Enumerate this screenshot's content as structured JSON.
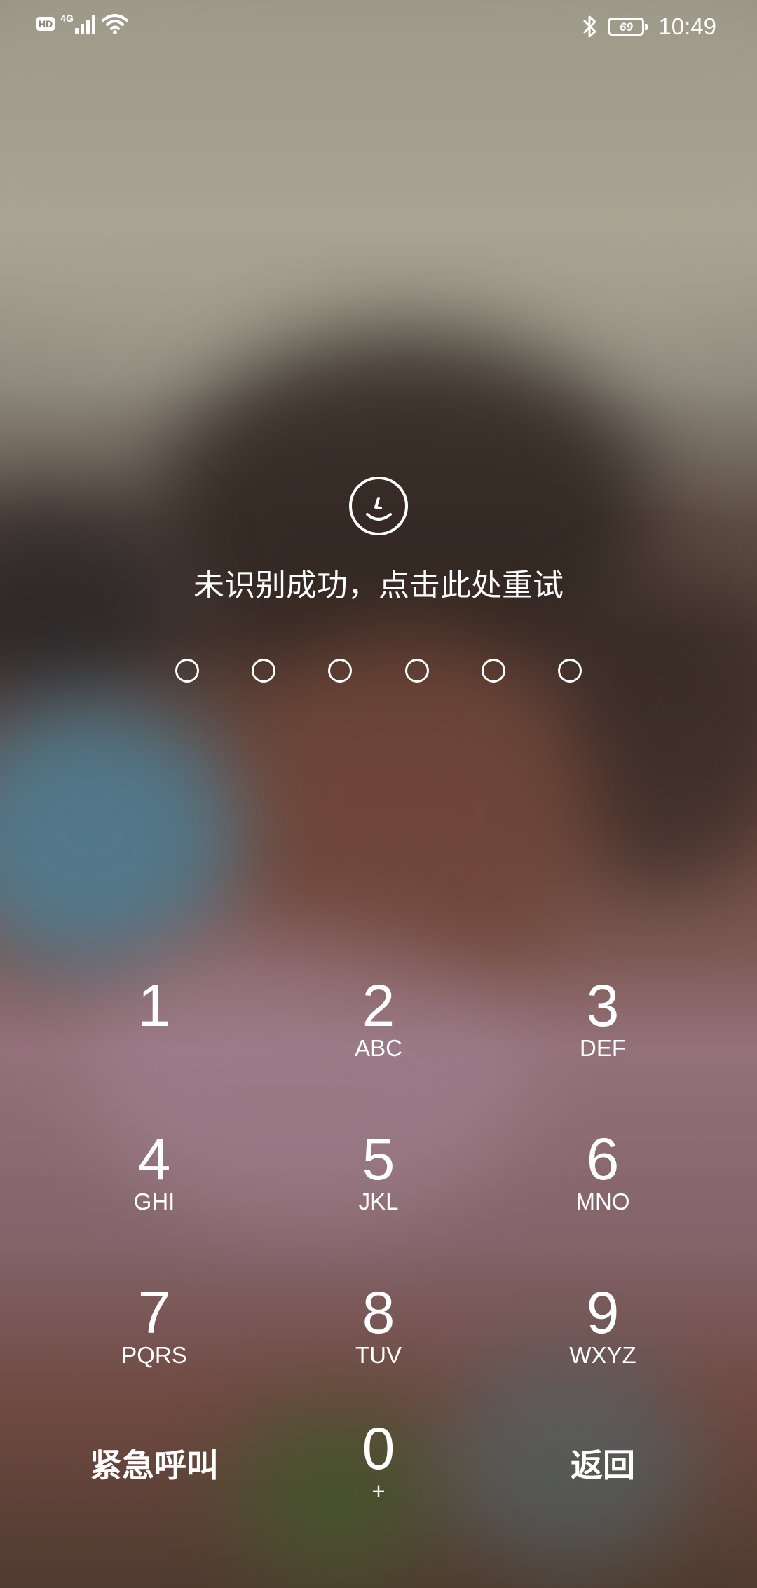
{
  "status_bar": {
    "hd_label": "HD",
    "network_type": "4G",
    "battery_level": "69",
    "time": "10:49",
    "icons": [
      "hd-icon",
      "signal-icon",
      "wifi-icon",
      "bluetooth-icon",
      "battery-icon"
    ]
  },
  "lock_screen": {
    "face_icon": "smiley-face-icon",
    "status_message": "未识别成功，点击此处重试",
    "pin_length": 6
  },
  "keypad": {
    "keys": [
      {
        "digit": "1",
        "letters": ""
      },
      {
        "digit": "2",
        "letters": "ABC"
      },
      {
        "digit": "3",
        "letters": "DEF"
      },
      {
        "digit": "4",
        "letters": "GHI"
      },
      {
        "digit": "5",
        "letters": "JKL"
      },
      {
        "digit": "6",
        "letters": "MNO"
      },
      {
        "digit": "7",
        "letters": "PQRS"
      },
      {
        "digit": "8",
        "letters": "TUV"
      },
      {
        "digit": "9",
        "letters": "WXYZ"
      },
      {
        "digit": "0",
        "letters": "+"
      }
    ],
    "emergency_label": "紧急呼叫",
    "back_label": "返回"
  },
  "colors": {
    "text": "#ffffff",
    "wallpaper_top": "#918d7f",
    "wallpaper_bottom": "#4f3b2f"
  }
}
